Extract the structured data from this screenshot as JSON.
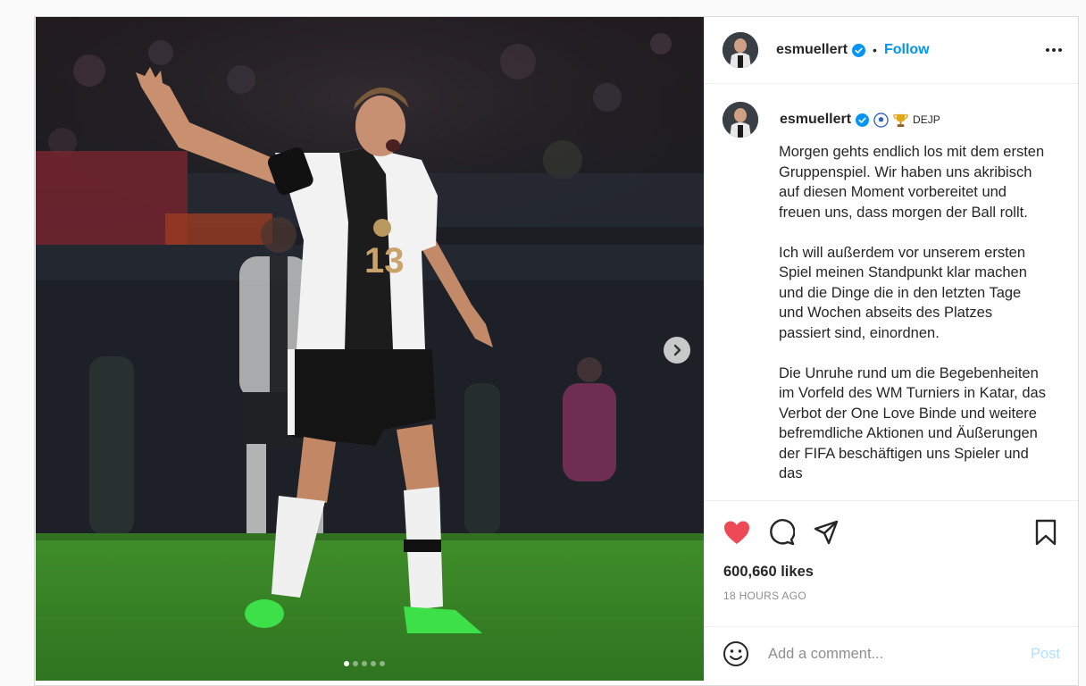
{
  "header": {
    "username": "esmuellert",
    "separator": "•",
    "follow_label": "Follow",
    "more_icon": "more-horizontal-icon"
  },
  "caption": {
    "username": "esmuellert",
    "badges": [
      "verified-icon",
      "soccer-ball-emoji",
      "trophy-emoji"
    ],
    "bio_tag": "DEJP",
    "paragraphs": [
      "Morgen gehts endlich los mit dem ersten Gruppenspiel. Wir haben uns akribisch auf diesen Moment vorbereitet und freuen uns, dass morgen der Ball rollt.",
      "Ich will außerdem vor unserem ersten Spiel meinen Standpunkt klar machen und die Dinge die in den letzten Tage und Wochen abseits des Platzes passiert sind, einordnen.",
      "Die Unruhe rund um die Begebenheiten im Vorfeld des WM Turniers in Katar, das Verbot der One Love Binde und weitere befremdliche Aktionen und Äußerungen der FIFA beschäftigen uns Spieler und das"
    ]
  },
  "actions": {
    "like_icon": "heart-filled-icon",
    "comment_icon": "comment-icon",
    "share_icon": "share-icon",
    "save_icon": "bookmark-icon",
    "likes": "600,660 likes",
    "timestamp": "18 HOURS AGO"
  },
  "comment_box": {
    "placeholder": "Add a comment...",
    "post_label": "Post"
  },
  "media": {
    "slide_count": 5,
    "active_slide": 1,
    "jersey_number": "13"
  },
  "colors": {
    "accent": "#0095f6",
    "like": "#ed4956",
    "post_disabled": "#b2dffc",
    "muted": "#8e8e8e"
  }
}
